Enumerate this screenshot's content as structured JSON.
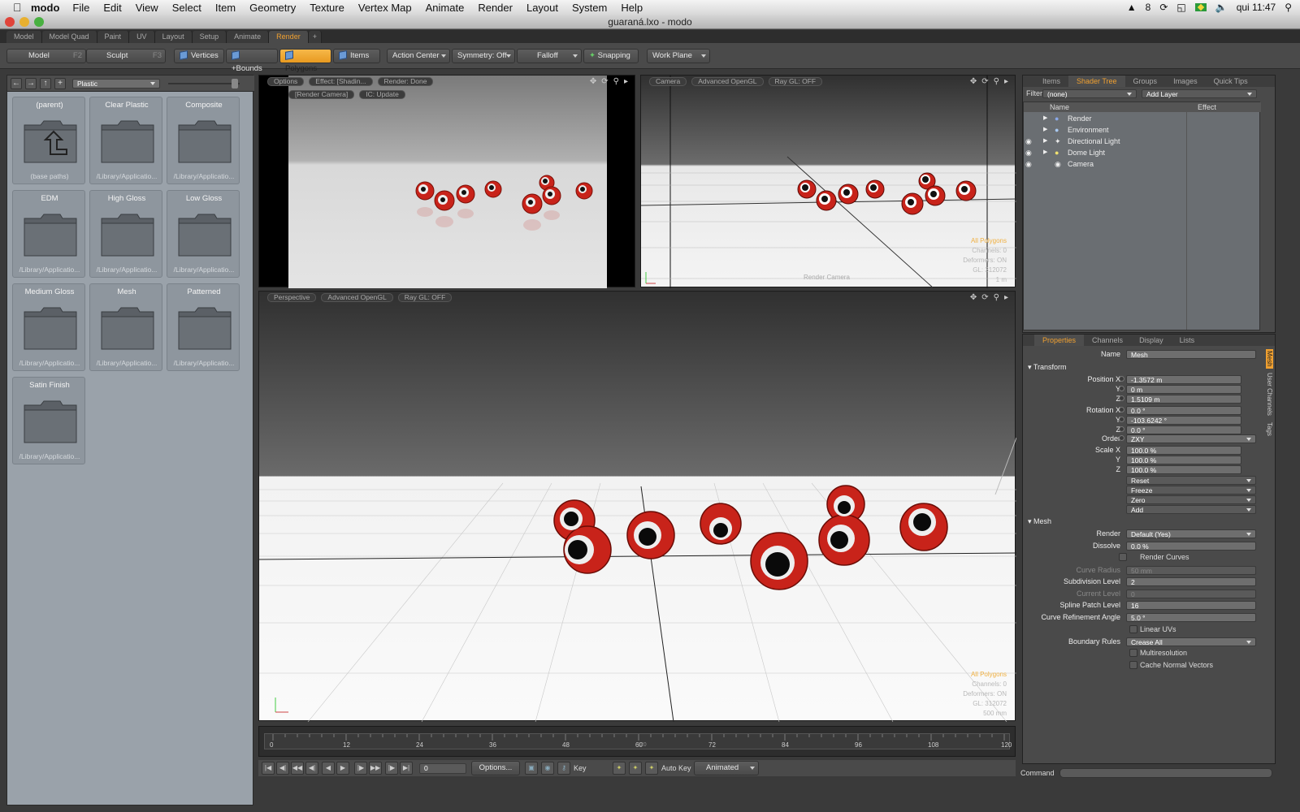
{
  "menubar": {
    "app": "modo",
    "items": [
      "File",
      "Edit",
      "View",
      "Select",
      "Item",
      "Geometry",
      "Texture",
      "Vertex Map",
      "Animate",
      "Render",
      "Layout",
      "System",
      "Help"
    ],
    "status_count": "8",
    "clock": "qui 11:47"
  },
  "window": {
    "title": "guaraná.lxo - modo"
  },
  "layout_tabs": [
    "Model",
    "Model Quad",
    "Paint",
    "UV",
    "Layout",
    "Setup",
    "Animate",
    "Render"
  ],
  "toolbar": {
    "model": "Model",
    "model_key": "F2",
    "sculpt": "Sculpt",
    "sculpt_key": "F3",
    "vertices": "Vertices",
    "bounds": "+Bounds",
    "polygons": "Polygons",
    "items": "Items",
    "action_center": "Action Center",
    "symmetry": "Symmetry: Off",
    "falloff": "Falloff",
    "snapping": "Snapping",
    "work_plane": "Work Plane"
  },
  "presets": {
    "category": "Plastic",
    "items": [
      {
        "name": "(parent)",
        "path": "(base paths)"
      },
      {
        "name": "Clear Plastic",
        "path": "/Library/Applicatio..."
      },
      {
        "name": "Composite",
        "path": "/Library/Applicatio..."
      },
      {
        "name": "EDM",
        "path": "/Library/Applicatio..."
      },
      {
        "name": "High Gloss",
        "path": "/Library/Applicatio..."
      },
      {
        "name": "Low Gloss",
        "path": "/Library/Applicatio..."
      },
      {
        "name": "Medium Gloss",
        "path": "/Library/Applicatio..."
      },
      {
        "name": "Mesh",
        "path": "/Library/Applicatio..."
      },
      {
        "name": "Patterned",
        "path": "/Library/Applicatio..."
      },
      {
        "name": "Satin Finish",
        "path": "/Library/Applicatio..."
      }
    ]
  },
  "vp_render": {
    "options": "Options",
    "effect": "Effect: [Shadin...",
    "status": "Render: Done",
    "camera": "[Render Camera]",
    "ic": "IC: Update"
  },
  "vp_camera": {
    "view": "Camera",
    "shading": "Advanced OpenGL",
    "raygl": "Ray GL: OFF",
    "overlay": [
      "All Polygons",
      "Channels: 0",
      "Deformers: ON",
      "GL: 312072",
      "1 m"
    ],
    "label": "Render Camera"
  },
  "vp_persp": {
    "view": "Perspective",
    "shading": "Advanced OpenGL",
    "raygl": "Ray GL: OFF",
    "overlay": [
      "All Polygons",
      "Channels: 0",
      "Deformers: ON",
      "GL: 312072",
      "500 mm"
    ]
  },
  "shader": {
    "tabs": [
      "Items",
      "Shader Tree",
      "Groups",
      "Images",
      "Quick Tips"
    ],
    "filter_label": "Filter",
    "filter": "(none)",
    "add_layer": "Add Layer",
    "col_name": "Name",
    "col_effect": "Effect",
    "rows": [
      "Render",
      "Environment",
      "Directional Light",
      "Dome Light",
      "Camera"
    ]
  },
  "props": {
    "tabs": [
      "Properties",
      "Channels",
      "Display",
      "Lists"
    ],
    "side_tabs": [
      "Mesh",
      "User Channels",
      "Tags"
    ],
    "name_label": "Name",
    "name": "Mesh",
    "transform": "Transform",
    "pos_label": "Position X",
    "pos": [
      "-1.3572 m",
      "0 m",
      "1.5109 m"
    ],
    "rot_label": "Rotation X",
    "rot": [
      "0.0 °",
      "-103.6242 °",
      "0.0 °"
    ],
    "order_label": "Order",
    "order": "ZXY",
    "scale_label": "Scale X",
    "scale": [
      "100.0 %",
      "100.0 %",
      "100.0 %"
    ],
    "y": "Y",
    "z": "Z",
    "actions": [
      "Reset",
      "Freeze",
      "Zero",
      "Add"
    ],
    "mesh": "Mesh",
    "render_label": "Render",
    "render": "Default (Yes)",
    "dissolve_label": "Dissolve",
    "dissolve": "0.0 %",
    "render_curves": "Render Curves",
    "curve_radius_label": "Curve Radius",
    "curve_radius": "50 mm",
    "subdiv_label": "Subdivision Level",
    "subdiv": "2",
    "current_label": "Current Level",
    "current": "0",
    "spline_label": "Spline Patch Level",
    "spline": "16",
    "refine_label": "Curve Refinement Angle",
    "refine": "5.0 °",
    "linear_uvs": "Linear UVs",
    "boundary_label": "Boundary Rules",
    "boundary": "Crease All",
    "multires": "Multiresolution",
    "cache": "Cache Normal Vectors"
  },
  "timeline": {
    "ticks": [
      "0",
      "12",
      "24",
      "36",
      "48",
      "60",
      "72",
      "84",
      "96",
      "108",
      "120"
    ],
    "mid": "120"
  },
  "playback": {
    "frame": "0",
    "options": "Options...",
    "key": "Key",
    "auto_key": "Auto Key",
    "mode": "Animated"
  },
  "command": {
    "label": "Command"
  }
}
